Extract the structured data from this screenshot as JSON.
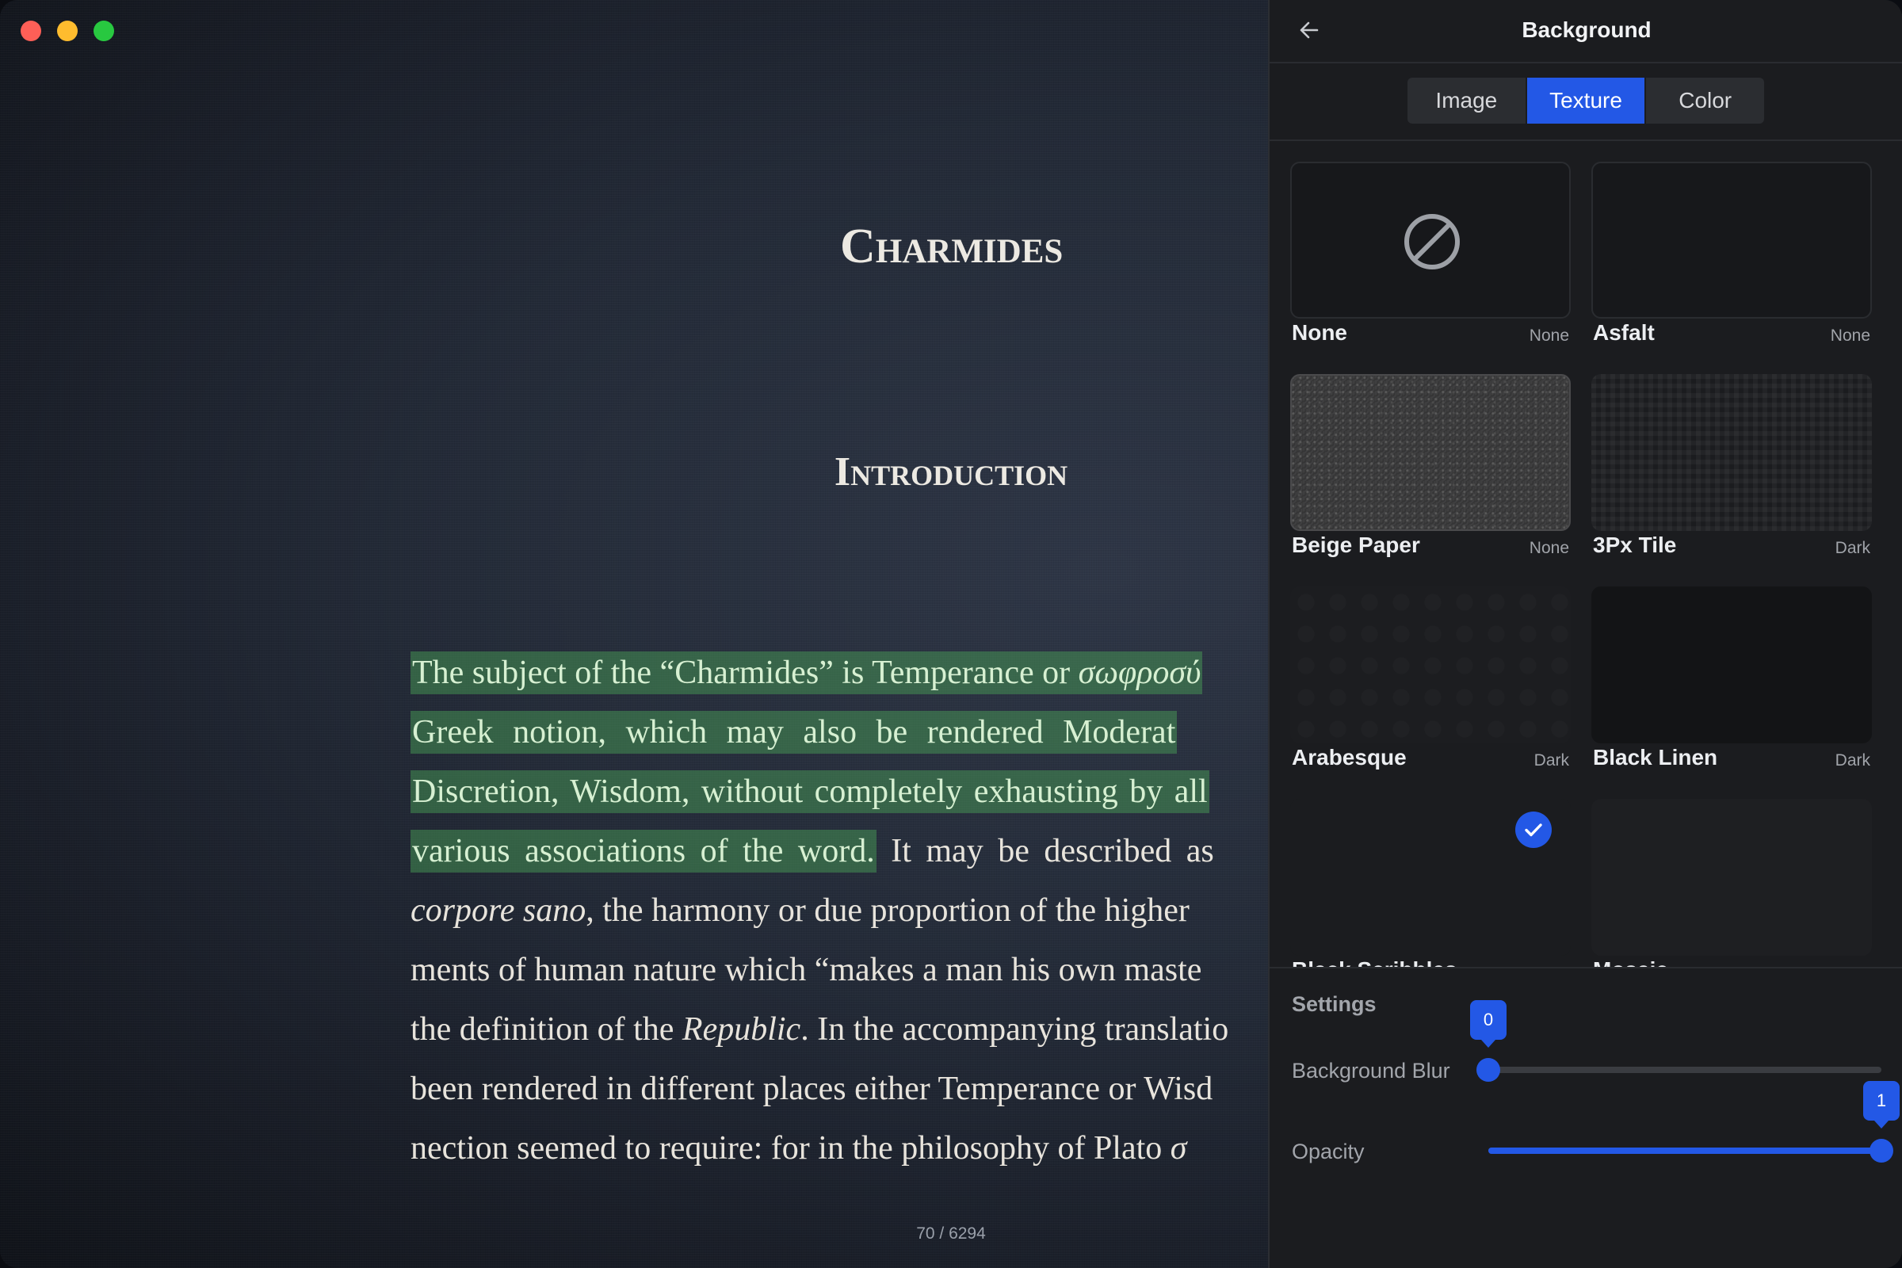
{
  "window": {
    "controls": [
      "close",
      "minimize",
      "maximize"
    ]
  },
  "reader": {
    "chapter_title": "Charmides",
    "section_title": "Introduction",
    "lines": [
      {
        "highlighted": "The subject of the “Charmides” is Temperance or ",
        "highlighted_italic": "σωφροσύ",
        "rest": ""
      },
      {
        "highlighted": "Greek notion, which may also be rendered Moderat",
        "rest": ""
      },
      {
        "highlighted": "Discretion, Wisdom, without completely exhausting by all ",
        "rest": ""
      },
      {
        "highlighted": "various associations of the word.",
        "rest": " It may be described as"
      },
      {
        "italic_start": "corpore sano",
        "rest": ", the harmony or due proportion of the higher"
      },
      {
        "text": "ments of human nature which “makes a man his own maste"
      },
      {
        "text_before": "the definition of the ",
        "italic": "Republic",
        "text_after": ". In the accompanying translatio"
      },
      {
        "text": "been rendered in different places either Temperance or Wisd"
      },
      {
        "text": "nection seemed to require: for in the philosophy of Plato ",
        "italic_end": "σ"
      }
    ],
    "page_indicator": "70 / 6294"
  },
  "panel": {
    "title": "Background",
    "back_icon": "arrow-left-icon",
    "tabs": [
      {
        "label": "Image",
        "active": false
      },
      {
        "label": "Texture",
        "active": true
      },
      {
        "label": "Color",
        "active": false
      }
    ],
    "textures": [
      {
        "name": "None",
        "tag": "None"
      },
      {
        "name": "Asfalt",
        "tag": "None"
      },
      {
        "name": "Beige Paper",
        "tag": "None"
      },
      {
        "name": "3Px Tile",
        "tag": "Dark"
      },
      {
        "name": "Arabesque",
        "tag": "Dark"
      },
      {
        "name": "Black Linen",
        "tag": "Dark"
      },
      {
        "name": "Black Scribbles",
        "tag": "",
        "selected": true
      },
      {
        "name": "Mosaic",
        "tag": ""
      }
    ],
    "settings": {
      "title": "Settings",
      "background_blur": {
        "label": "Background Blur",
        "value": "0",
        "fraction": 0
      },
      "opacity": {
        "label": "Opacity",
        "value": "1",
        "fraction": 1
      }
    }
  },
  "colors": {
    "accent": "#2358e6",
    "highlight": "#4ca658",
    "panel_bg": "#1b1c1f"
  }
}
